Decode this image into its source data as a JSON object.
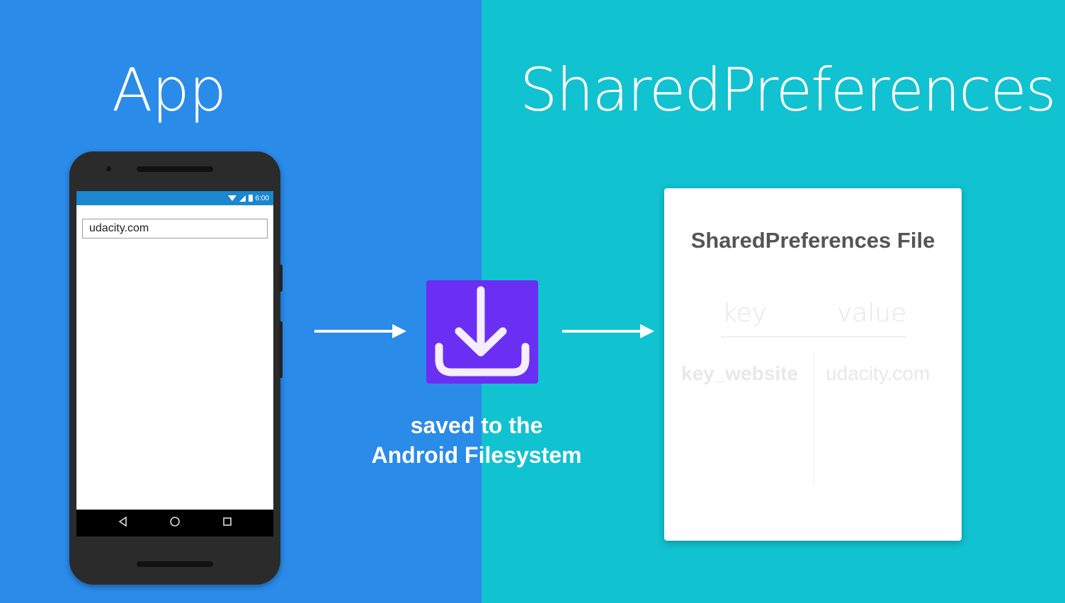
{
  "headings": {
    "left": "App",
    "right": "SharedPreferences"
  },
  "phone": {
    "status_time": "6:00",
    "url_value": "udacity.com"
  },
  "caption": {
    "line1": "saved to the",
    "line2": "Android Filesystem"
  },
  "card": {
    "title": "SharedPreferences File",
    "column_key": "key",
    "column_value": "value",
    "rows": [
      {
        "key": "key_website",
        "value": "udacity.com"
      }
    ]
  },
  "colors": {
    "left_panel": "#2a8be8",
    "right_panel": "#11c2d0",
    "download_icon_bg": "#6b2ff4"
  },
  "icons": [
    "download-icon",
    "arrow-right-icon",
    "wifi-icon",
    "signal-icon",
    "battery-icon",
    "nav-back-icon",
    "nav-home-icon",
    "nav-recent-icon"
  ]
}
